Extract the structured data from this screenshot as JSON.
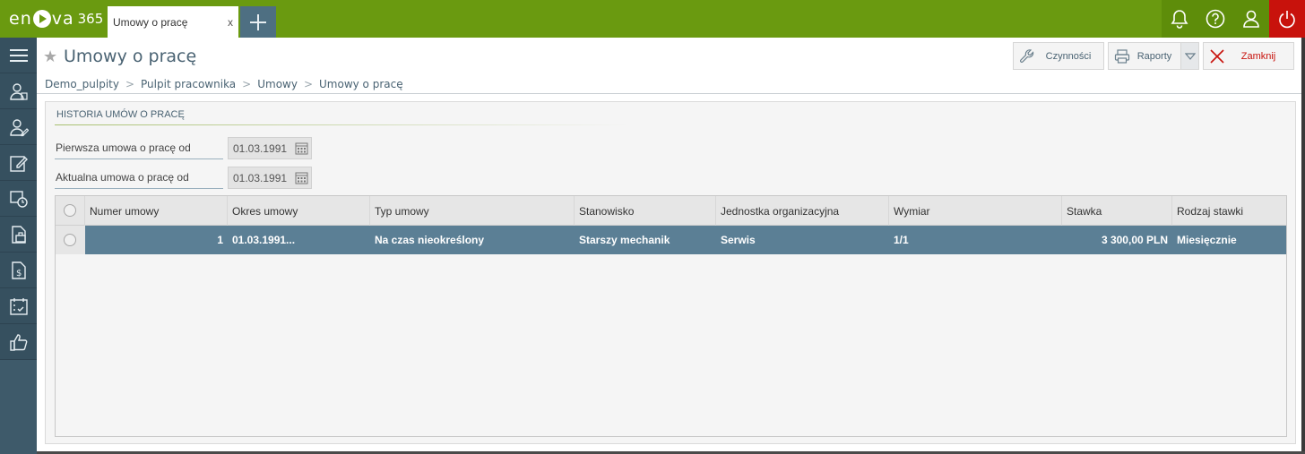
{
  "app": {
    "logo_brand": "en va",
    "logo_version": "365",
    "tab_label": "Umowy o pracę",
    "tab_close": "x"
  },
  "toolbar": {
    "icons": [
      "bell-icon",
      "help-icon",
      "user-icon",
      "power-icon"
    ],
    "power_color": "#c8120c",
    "brand_color": "#6a9a10"
  },
  "sidebar": {
    "items": [
      "menu-icon",
      "employee-icon",
      "employee-edit-icon",
      "edit-icon",
      "time-history-icon",
      "leave-icon",
      "salary-icon",
      "calendar-check-icon",
      "thumbs-up-icon"
    ]
  },
  "page": {
    "title": "Umowy o pracę",
    "actions": {
      "czynnosci": "Czynności",
      "raporty": "Raporty",
      "zamknij": "Zamknij"
    },
    "breadcrumb": [
      "Demo_pulpity",
      "Pulpit pracownika",
      "Umowy",
      "Umowy o pracę"
    ]
  },
  "section": {
    "title": "HISTORIA UMÓW O PRACĘ",
    "fields": [
      {
        "label": "Pierwsza umowa o pracę od",
        "value": "01.03.1991"
      },
      {
        "label": "Aktualna umowa o pracę od",
        "value": "01.03.1991"
      }
    ]
  },
  "grid": {
    "columns": [
      "Numer umowy",
      "Okres umowy",
      "Typ umowy",
      "Stanowisko",
      "Jednostka organizacyjna",
      "Wymiar",
      "Stawka",
      "Rodzaj stawki"
    ],
    "rows": [
      [
        "1",
        "01.03.1991...",
        "Na czas nieokreślony",
        "Starszy mechanik",
        "Serwis",
        "1/1",
        "3 300,00 PLN",
        "Miesięcznie"
      ]
    ],
    "selected_row_color": "#5b7f95"
  }
}
